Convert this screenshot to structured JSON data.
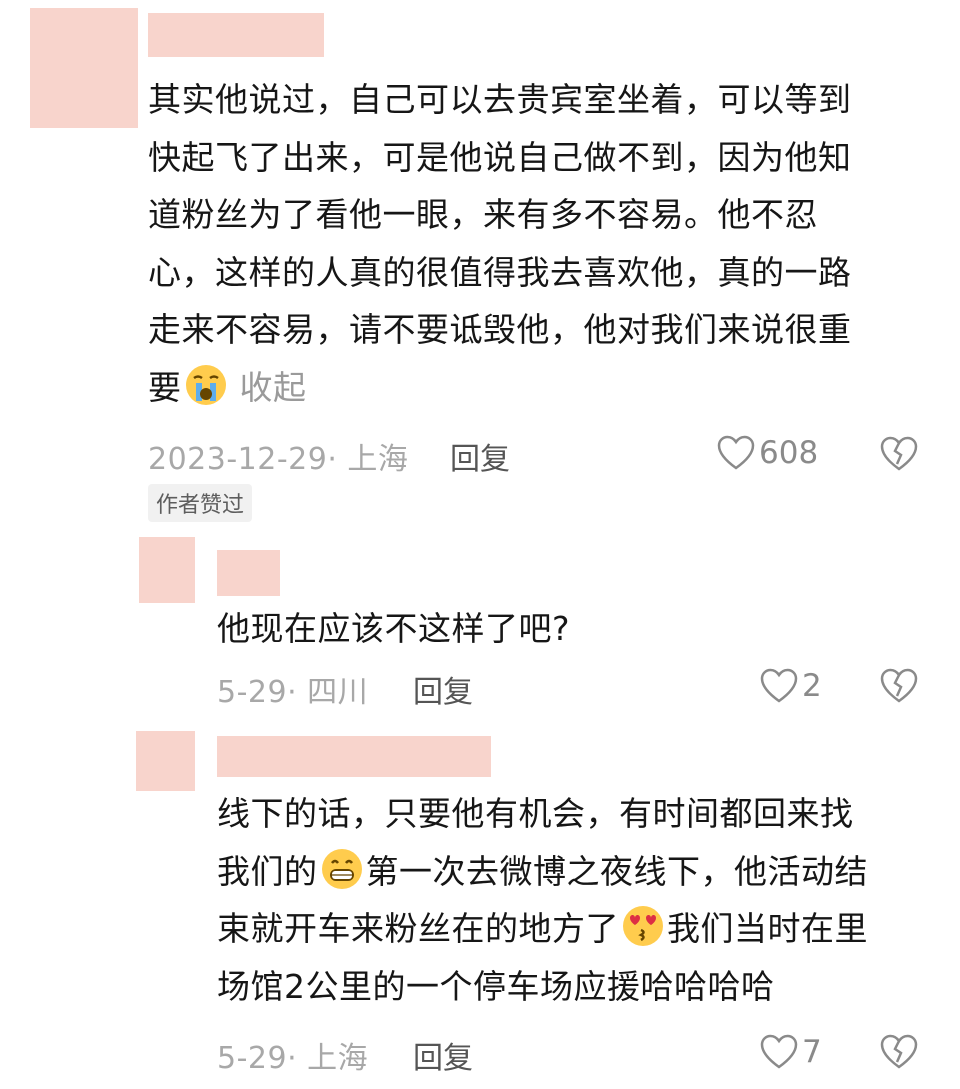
{
  "comments": [
    {
      "text_lines": [
        "其实他说过，自己可以去贵宾室坐着，可以等到",
        "快起飞了出来，可是他说自己做不到，因为他知",
        "道粉丝为了看他一眼，来有多不容易。他不忍",
        "心，这样的人真的很值得我去喜欢他，真的一路",
        "走来不容易，请不要诋毁他，他对我们来说很重",
        "要"
      ],
      "emoji": "loudly-crying-face",
      "collapse_label": "收起",
      "meta": "2023-12-29· 上海",
      "reply_label": "回复",
      "likes": "608",
      "author_tag": "作者赞过"
    },
    {
      "text_lines": [
        "他现在应该不这样了吧?"
      ],
      "meta": "5-29· 四川",
      "reply_label": "回复",
      "likes": "2"
    },
    {
      "line1": "线下的话，只要他有机会，有时间都回来找",
      "line2_a": "我们的",
      "line2_b": "第一次去微博之夜线下，他活动结",
      "line3_a": "束就开车来粉丝在的地方了",
      "line3_b": "我们当时在里",
      "line4": "场馆2公里的一个停车场应援哈哈哈哈",
      "emoji_1": "grinning-face",
      "emoji_2": "face-blowing-a-kiss",
      "meta": "5-29· 上海",
      "reply_label": "回复",
      "likes": "7"
    }
  ],
  "colors": {
    "redaction": "#f8d4cc",
    "meta_text": "#a8a8a8",
    "like_icon": "#8a8a8a"
  }
}
